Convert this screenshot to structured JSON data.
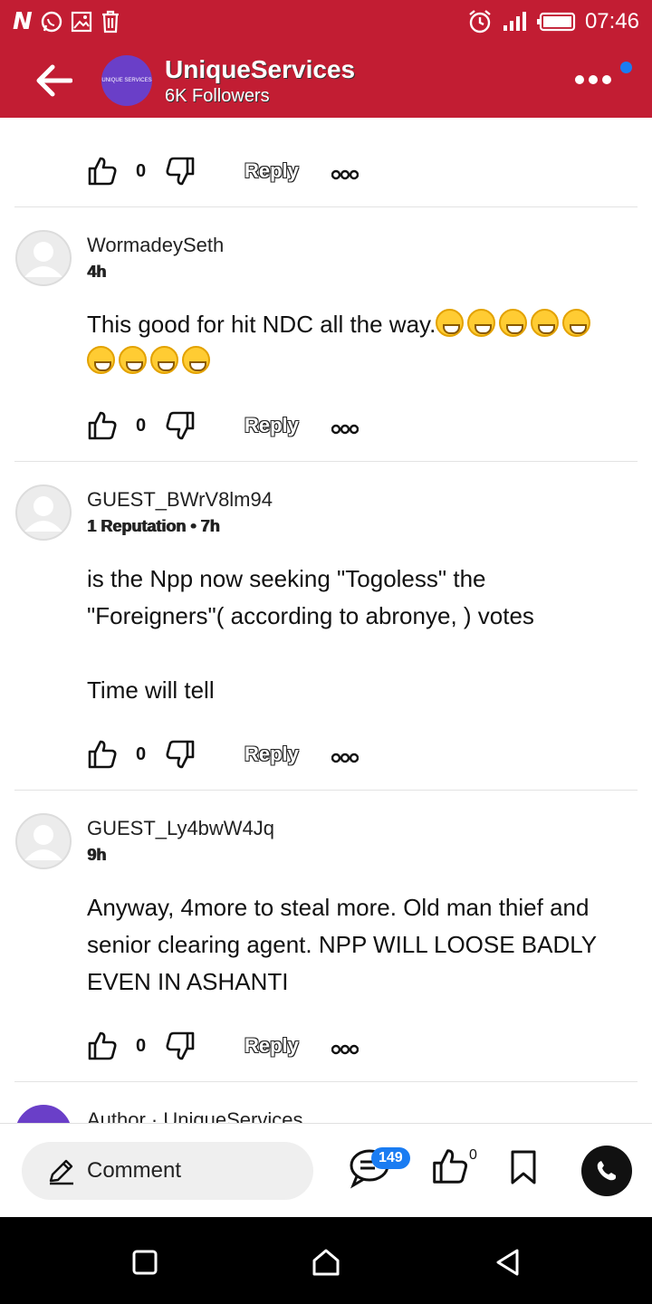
{
  "status_bar": {
    "time": "07:46",
    "left_icons": [
      "app-n-icon",
      "whatsapp-icon",
      "gallery-icon",
      "trash-icon"
    ],
    "right_icons": [
      "alarm-icon",
      "signal-icon",
      "battery-icon"
    ]
  },
  "header": {
    "channel_name": "UniqueServices",
    "followers": "6K Followers",
    "avatar_text": "UNIQUE SERVICES",
    "colors": {
      "bar": "#c21d33",
      "dot": "#1a7cf2"
    }
  },
  "comments": [
    {
      "username": "WormadeySeth",
      "meta": "4h",
      "text_lines": [
        "This good for hit NDC all the way."
      ],
      "emoji_count_line1": 5,
      "emoji_count_line2": 4,
      "likes": "0",
      "reply_label": "Reply"
    },
    {
      "username": "GUEST_BWrV8lm94",
      "meta": "1 Reputation • 7h",
      "text_lines": [
        "is the Npp now seeking \"Togoless\" the \"Foreigners\"( according to abronye, ) votes",
        "Time will tell"
      ],
      "likes": "0",
      "reply_label": "Reply"
    },
    {
      "username": "GUEST_Ly4bwW4Jq",
      "meta": "9h",
      "text_lines": [
        "Anyway, 4more to steal more. Old man thief and senior clearing agent. NPP WILL LOOSE BADLY EVEN IN ASHANTI"
      ],
      "likes": "0",
      "reply_label": "Reply"
    }
  ],
  "top_partial_actions": {
    "likes": "0",
    "reply_label": "Reply"
  },
  "partial_author": "Author · UniqueServices",
  "bottom_bar": {
    "comment_label": "Comment",
    "comment_count": "149",
    "like_count": "0"
  }
}
